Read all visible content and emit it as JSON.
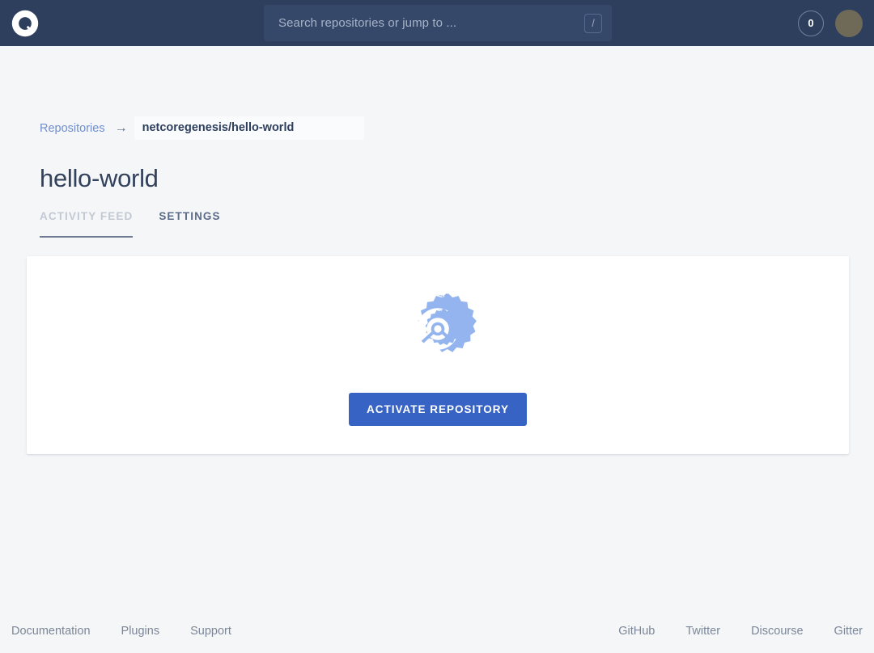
{
  "header": {
    "logo_name": "drone-logo",
    "search": {
      "placeholder": "Search repositories or jump to ...",
      "value": "",
      "shortcut_badge": "/"
    },
    "build_count": "0",
    "avatar_label": ""
  },
  "breadcrumb": {
    "root_label": "Repositories",
    "separator": "→",
    "current": "netcoregenesis/hello-world"
  },
  "main": {
    "title": "hello-world",
    "tabs": [
      {
        "label": "ACTIVITY FEED",
        "active": true
      },
      {
        "label": "SETTINGS",
        "active": false
      }
    ],
    "empty_state": {
      "icon": "gear-icon",
      "activate_label": "ACTIVATE REPOSITORY"
    }
  },
  "footer": {
    "left_links": [
      {
        "label": "Documentation"
      },
      {
        "label": "Plugins"
      },
      {
        "label": "Support"
      }
    ],
    "right_links": [
      {
        "label": "GitHub"
      },
      {
        "label": "Twitter"
      },
      {
        "label": "Discourse"
      },
      {
        "label": "Gitter"
      }
    ]
  },
  "colors": {
    "header_bg": "#2e3f5e",
    "page_bg": "#f5f6f8",
    "accent_blue": "#3663c4",
    "link_blue": "#6f8fd0",
    "gear_blue": "#93b4ee",
    "muted_text": "#7b8798"
  }
}
